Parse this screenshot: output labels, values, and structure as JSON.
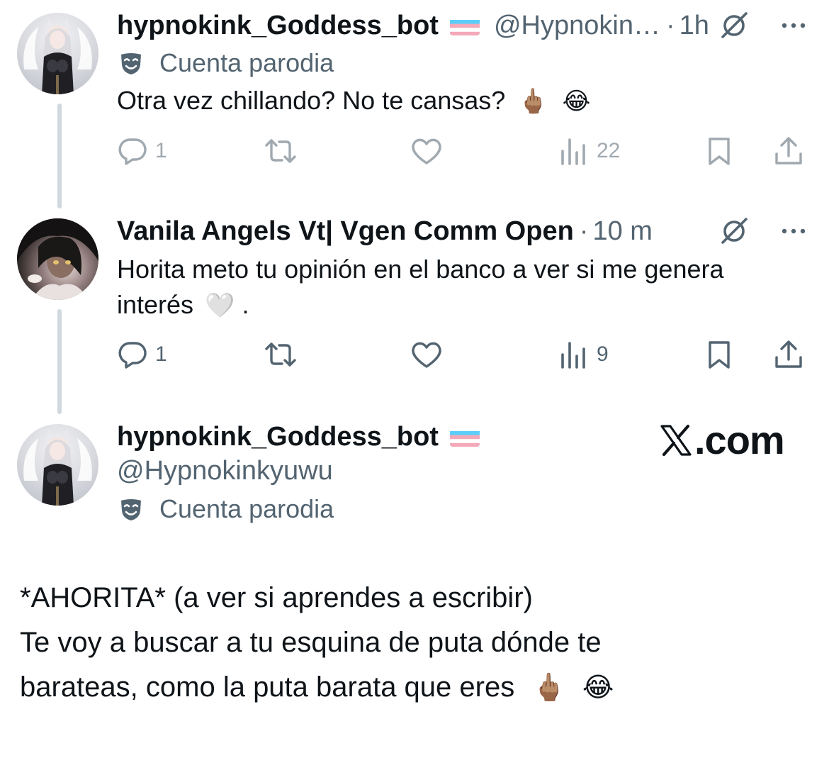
{
  "tweets": [
    {
      "display_name": "hypnokink_Goddess_bot",
      "handle": "@Hypnokin…",
      "time": "1h",
      "parody_label": "Cuenta parodia",
      "text": "Otra vez chillando? No te cansas?",
      "emojis": [
        "🖕🏽",
        "😂"
      ],
      "stats": {
        "replies": "1",
        "reposts": "",
        "likes": "",
        "views": "22"
      }
    },
    {
      "display_name": "Vanila Angels Vt| Vgen Comm Open",
      "time": "10 m",
      "text_line1": "Horita meto tu opinión en el banco a ver si me genera",
      "text_line2": "interés",
      "text_line2_suffix": ".",
      "emoji": "🤍",
      "stats": {
        "replies": "1",
        "reposts": "",
        "likes": "",
        "views": "9"
      }
    }
  ],
  "main_post": {
    "display_name": "hypnokink_Goddess_bot",
    "handle": "@Hypnokinkyuwu",
    "parody_label": "Cuenta parodia",
    "lines": [
      "*AHORITA* (a ver si aprendes a escribir)",
      "Te voy a buscar a tu esquina de puta dónde te",
      "barateas, como la puta barata que eres"
    ],
    "emojis": [
      "🖕🏽",
      "😂"
    ]
  },
  "watermark": ".com",
  "icons": {
    "reply": "reply-icon",
    "repost": "repost-icon",
    "like": "heart-icon",
    "views": "views-icon",
    "bookmark": "bookmark-icon",
    "share": "share-icon",
    "grok": "grok-icon",
    "more": "more-icon",
    "parody": "parody-mask-icon",
    "flag": "trans-flag-icon"
  },
  "colors": {
    "text": "#0f1419",
    "secondary": "#536471",
    "thread_line": "#cfd9de",
    "flag_blue": "#5bcefa",
    "flag_pink": "#f5a9b8"
  }
}
